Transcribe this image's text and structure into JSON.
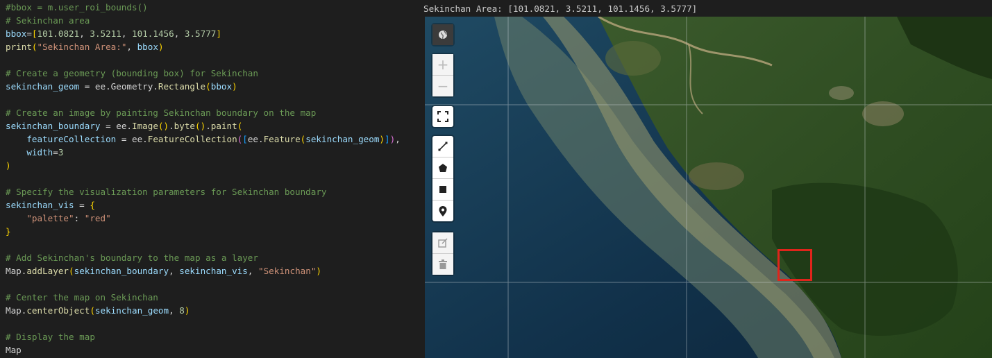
{
  "editor": {
    "lines": [
      [
        {
          "c": "t-cm",
          "t": "#bbox = m.user_roi_bounds()"
        }
      ],
      [
        {
          "c": "t-cm",
          "t": "# Sekinchan area"
        }
      ],
      [
        {
          "c": "t-vr",
          "t": "bbox"
        },
        {
          "c": "t-tx",
          "t": "="
        },
        {
          "c": "t-b1",
          "t": "["
        },
        {
          "c": "t-nm",
          "t": "101.0821"
        },
        {
          "c": "t-tx",
          "t": ", "
        },
        {
          "c": "t-nm",
          "t": "3.5211"
        },
        {
          "c": "t-tx",
          "t": ", "
        },
        {
          "c": "t-nm",
          "t": "101.1456"
        },
        {
          "c": "t-tx",
          "t": ", "
        },
        {
          "c": "t-nm",
          "t": "3.5777"
        },
        {
          "c": "t-b1",
          "t": "]"
        }
      ],
      [
        {
          "c": "t-fn",
          "t": "print"
        },
        {
          "c": "t-b1",
          "t": "("
        },
        {
          "c": "t-st",
          "t": "\"Sekinchan Area:\""
        },
        {
          "c": "t-tx",
          "t": ", "
        },
        {
          "c": "t-vr",
          "t": "bbox"
        },
        {
          "c": "t-b1",
          "t": ")"
        }
      ],
      [],
      [
        {
          "c": "t-cm",
          "t": "# Create a geometry (bounding box) for Sekinchan"
        }
      ],
      [
        {
          "c": "t-vr",
          "t": "sekinchan_geom"
        },
        {
          "c": "t-tx",
          "t": " = ee.Geometry."
        },
        {
          "c": "t-fn",
          "t": "Rectangle"
        },
        {
          "c": "t-b1",
          "t": "("
        },
        {
          "c": "t-vr",
          "t": "bbox"
        },
        {
          "c": "t-b1",
          "t": ")"
        }
      ],
      [],
      [
        {
          "c": "t-cm",
          "t": "# Create an image by painting Sekinchan boundary on the map"
        }
      ],
      [
        {
          "c": "t-vr",
          "t": "sekinchan_boundary"
        },
        {
          "c": "t-tx",
          "t": " = ee."
        },
        {
          "c": "t-fn",
          "t": "Image"
        },
        {
          "c": "t-b1",
          "t": "()"
        },
        {
          "c": "t-tx",
          "t": "."
        },
        {
          "c": "t-fn",
          "t": "byte"
        },
        {
          "c": "t-b1",
          "t": "()"
        },
        {
          "c": "t-tx",
          "t": "."
        },
        {
          "c": "t-fn",
          "t": "paint"
        },
        {
          "c": "t-b1",
          "t": "("
        }
      ],
      [
        {
          "c": "t-tx",
          "t": "    "
        },
        {
          "c": "t-vr",
          "t": "featureCollection"
        },
        {
          "c": "t-tx",
          "t": " = ee."
        },
        {
          "c": "t-fn",
          "t": "FeatureCollection"
        },
        {
          "c": "t-b2",
          "t": "("
        },
        {
          "c": "t-b3",
          "t": "["
        },
        {
          "c": "t-tx",
          "t": "ee."
        },
        {
          "c": "t-fn",
          "t": "Feature"
        },
        {
          "c": "t-b1",
          "t": "("
        },
        {
          "c": "t-vr",
          "t": "sekinchan_geom"
        },
        {
          "c": "t-b1",
          "t": ")"
        },
        {
          "c": "t-b3",
          "t": "]"
        },
        {
          "c": "t-b2",
          "t": ")"
        },
        {
          "c": "t-tx",
          "t": ","
        }
      ],
      [
        {
          "c": "t-tx",
          "t": "    "
        },
        {
          "c": "t-vr",
          "t": "width"
        },
        {
          "c": "t-tx",
          "t": "="
        },
        {
          "c": "t-nm",
          "t": "3"
        }
      ],
      [
        {
          "c": "t-b1",
          "t": ")"
        }
      ],
      [],
      [
        {
          "c": "t-cm",
          "t": "# Specify the visualization parameters for Sekinchan boundary"
        }
      ],
      [
        {
          "c": "t-vr",
          "t": "sekinchan_vis"
        },
        {
          "c": "t-tx",
          "t": " = "
        },
        {
          "c": "t-b1",
          "t": "{"
        }
      ],
      [
        {
          "c": "t-tx",
          "t": "    "
        },
        {
          "c": "t-st",
          "t": "\"palette\""
        },
        {
          "c": "t-tx",
          "t": ": "
        },
        {
          "c": "t-st",
          "t": "\"red\""
        }
      ],
      [
        {
          "c": "t-b1",
          "t": "}"
        }
      ],
      [],
      [
        {
          "c": "t-cm",
          "t": "# Add Sekinchan's boundary to the map as a layer"
        }
      ],
      [
        {
          "c": "t-tx",
          "t": "Map."
        },
        {
          "c": "t-fn",
          "t": "addLayer"
        },
        {
          "c": "t-b1",
          "t": "("
        },
        {
          "c": "t-vr",
          "t": "sekinchan_boundary"
        },
        {
          "c": "t-tx",
          "t": ", "
        },
        {
          "c": "t-vr",
          "t": "sekinchan_vis"
        },
        {
          "c": "t-tx",
          "t": ", "
        },
        {
          "c": "t-st",
          "t": "\"Sekinchan\""
        },
        {
          "c": "t-b1",
          "t": ")"
        }
      ],
      [],
      [
        {
          "c": "t-cm",
          "t": "# Center the map on Sekinchan"
        }
      ],
      [
        {
          "c": "t-tx",
          "t": "Map."
        },
        {
          "c": "t-fn",
          "t": "centerObject"
        },
        {
          "c": "t-b1",
          "t": "("
        },
        {
          "c": "t-vr",
          "t": "sekinchan_geom"
        },
        {
          "c": "t-tx",
          "t": ", "
        },
        {
          "c": "t-nm",
          "t": "8"
        },
        {
          "c": "t-b1",
          "t": ")"
        }
      ],
      [],
      [
        {
          "c": "t-cm",
          "t": "# Display the map"
        }
      ],
      [
        {
          "c": "t-tx",
          "t": "Map"
        }
      ]
    ]
  },
  "output": {
    "text": "Sekinchan Area: [101.0821, 3.5211, 101.1456, 3.5777]"
  },
  "map": {
    "controls": {
      "basemap_icon": "globe-icon",
      "zoom_in_label": "+",
      "zoom_out_label": "−",
      "fullscreen_icon": "fullscreen-icon",
      "draw_tools": [
        "polyline-icon",
        "polygon-icon",
        "rectangle-icon",
        "marker-icon"
      ],
      "edit_tools": [
        "edit-icon",
        "trash-icon"
      ]
    },
    "roi_color": "#e0241b"
  }
}
